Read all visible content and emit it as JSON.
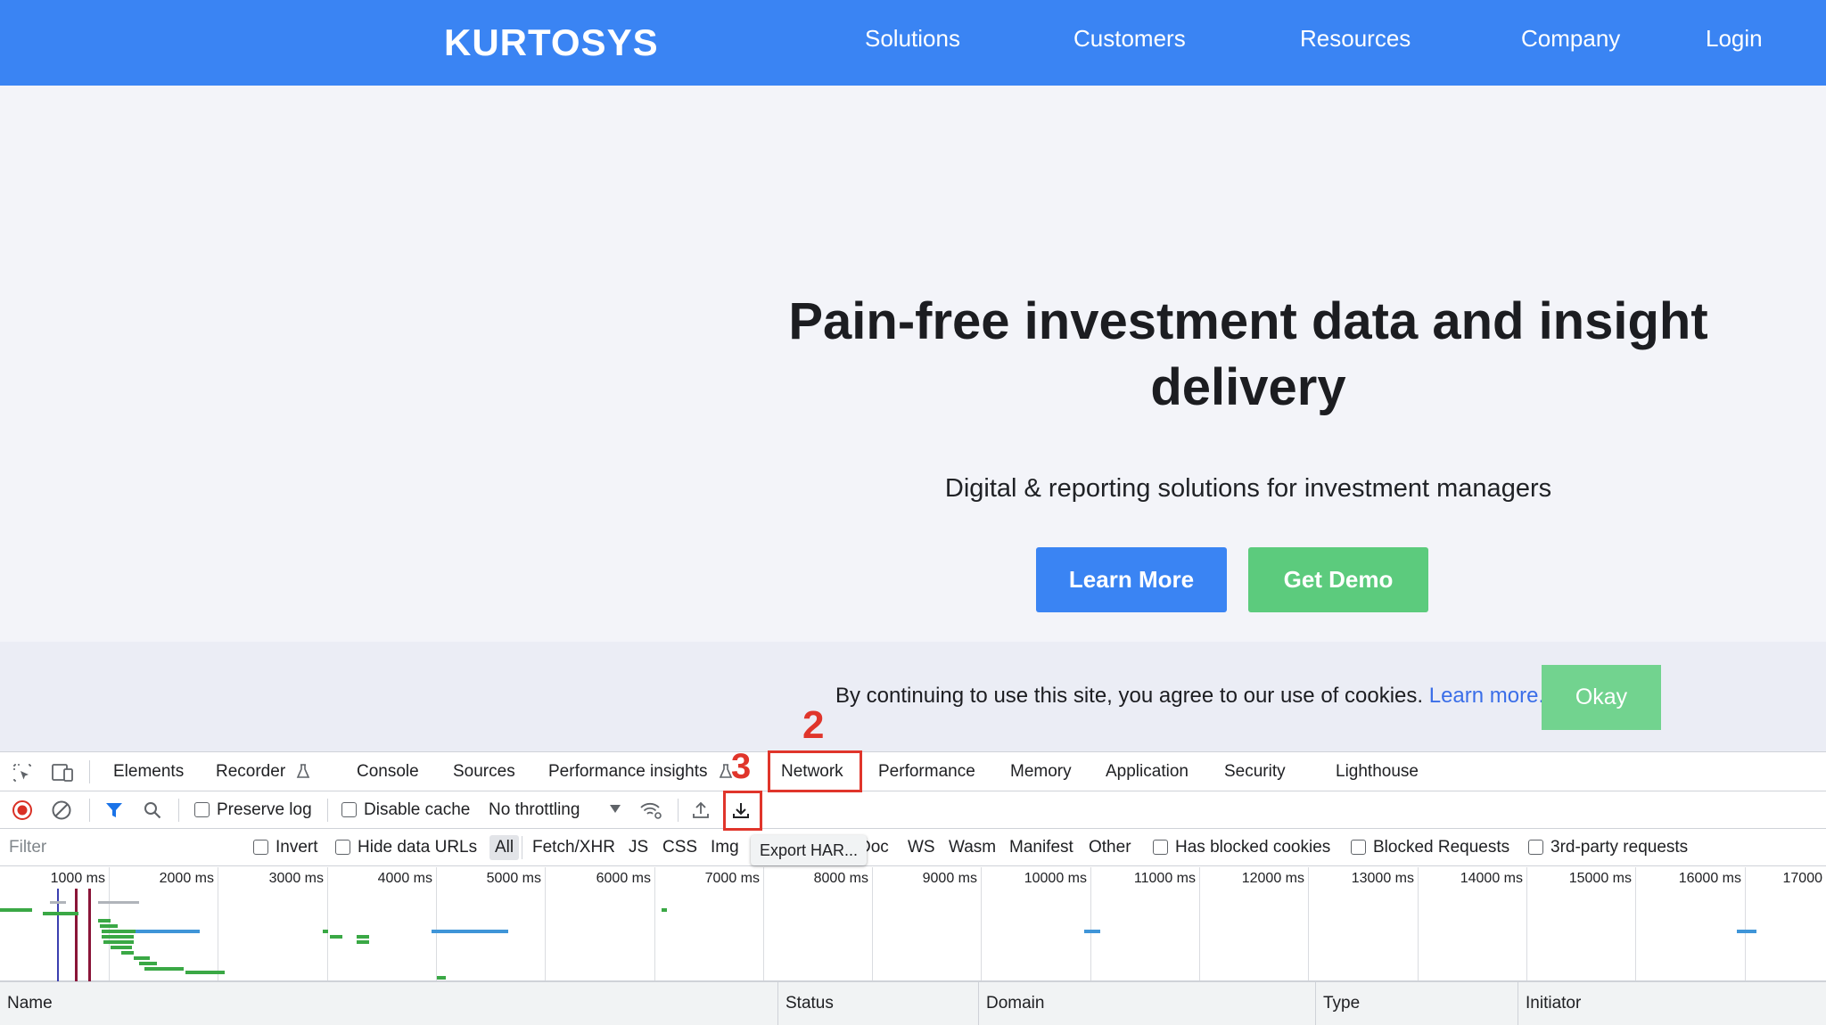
{
  "nav": {
    "logo": "KURTOSYS",
    "links": [
      "Solutions",
      "Customers",
      "Resources",
      "Company",
      "Login"
    ]
  },
  "hero": {
    "title": "Pain-free investment data and insight delivery",
    "subtitle": "Digital & reporting solutions for investment managers",
    "learn_more": "Learn More",
    "get_demo": "Get Demo"
  },
  "cookie": {
    "text": "By continuing to use this site, you agree to our use of cookies.",
    "link": "Learn more.",
    "okay": "Okay"
  },
  "annotations": {
    "step2": "2",
    "step3": "3"
  },
  "devtools": {
    "tabs": [
      "Elements",
      "Recorder",
      "Console",
      "Sources",
      "Performance insights",
      "Network",
      "Performance",
      "Memory",
      "Application",
      "Security",
      "Lighthouse"
    ],
    "active_tab": "Network",
    "toolbar": {
      "preserve_log": "Preserve log",
      "disable_cache": "Disable cache",
      "throttling": "No throttling"
    },
    "tooltip": "Export HAR...",
    "filter": {
      "placeholder": "Filter",
      "invert": "Invert",
      "hide_data_urls": "Hide data URLs",
      "types": [
        "All",
        "Fetch/XHR",
        "JS",
        "CSS",
        "Img",
        "Doc",
        "WS",
        "Wasm",
        "Manifest",
        "Other"
      ],
      "has_blocked_cookies": "Has blocked cookies",
      "blocked_requests": "Blocked Requests",
      "third_party": "3rd-party requests"
    },
    "timeline_ticks": [
      "1000 ms",
      "2000 ms",
      "3000 ms",
      "4000 ms",
      "5000 ms",
      "6000 ms",
      "7000 ms",
      "8000 ms",
      "9000 ms",
      "10000 ms",
      "11000 ms",
      "12000 ms",
      "13000 ms",
      "14000 ms",
      "15000 ms",
      "16000 ms",
      "17000"
    ],
    "columns": [
      "Name",
      "Status",
      "Domain",
      "Type",
      "Initiator"
    ]
  },
  "colors": {
    "brand_blue": "#3a84f3",
    "demo_green": "#5ccb7d",
    "annotation_red": "#e0352b"
  }
}
